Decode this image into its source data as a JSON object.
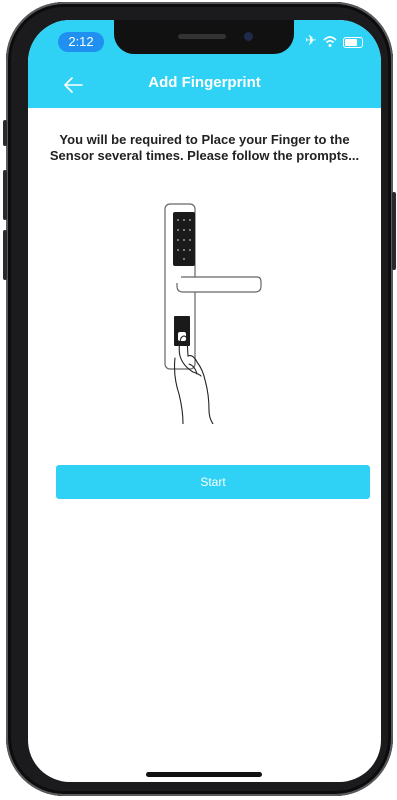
{
  "status_bar": {
    "time": "2:12"
  },
  "header": {
    "title": "Add Fingerprint",
    "back_icon": "arrow-left-icon"
  },
  "main": {
    "instruction": "You will be required to Place your Finger to the Sensor several times. Please follow the prompts...",
    "illustration": "door-lock-fingerprint-illustration",
    "start_label": "Start"
  },
  "colors": {
    "accent": "#2fd2f4",
    "time_pill": "#1f8ff0"
  }
}
